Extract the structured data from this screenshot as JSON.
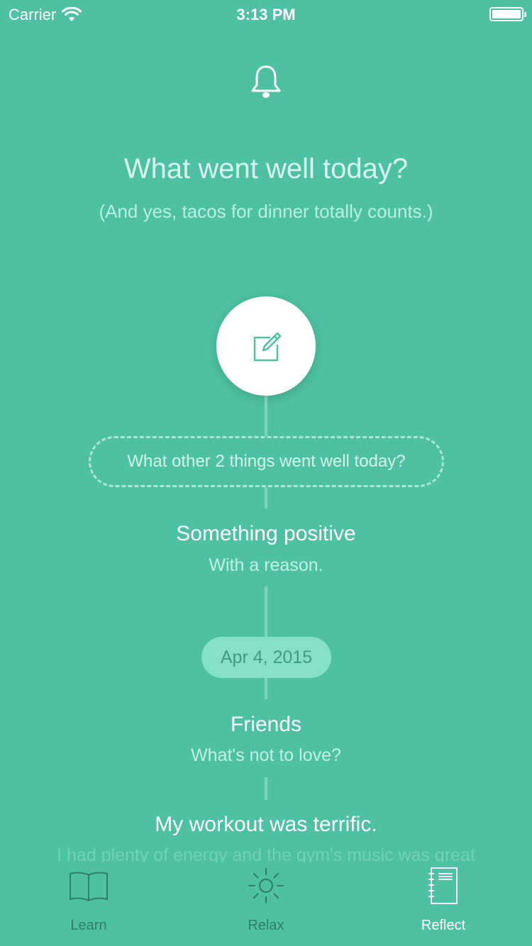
{
  "status_bar": {
    "carrier": "Carrier",
    "time": "3:13 PM"
  },
  "header": {
    "icon": "bell-icon",
    "title": "What went well today?",
    "subtitle": "(And yes, tacos for dinner totally counts.)"
  },
  "compose": {
    "icon": "compose-icon"
  },
  "prompt": {
    "label": "What other 2 things went well today?"
  },
  "entries": [
    {
      "title": "Something positive",
      "subtitle": "With a reason."
    },
    {
      "title": "Friends",
      "subtitle": "What's not to love?"
    },
    {
      "title": "My workout was terrific.",
      "subtitle": "I had plenty of energy and the gym's music was great"
    }
  ],
  "date_marker": {
    "label": "Apr 4, 2015"
  },
  "tabbar": {
    "tabs": [
      {
        "label": "Learn",
        "icon": "book-icon",
        "active": false
      },
      {
        "label": "Relax",
        "icon": "sun-icon",
        "active": false
      },
      {
        "label": "Reflect",
        "icon": "notebook-icon",
        "active": true
      }
    ]
  },
  "colors": {
    "background": "#4dc1a1",
    "accent_white": "#ffffff",
    "date_pill": "#84e0c6",
    "tab_inactive": "#2f7f69"
  }
}
